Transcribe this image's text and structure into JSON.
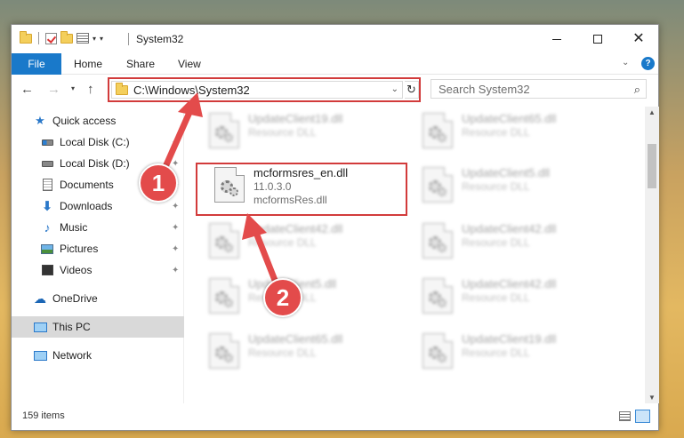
{
  "window": {
    "title": "System32"
  },
  "ribbon": {
    "file": "File",
    "home": "Home",
    "share": "Share",
    "view": "View"
  },
  "address": {
    "path": "C:\\Windows\\System32"
  },
  "search": {
    "placeholder": "Search System32"
  },
  "nav": {
    "quick_access": "Quick access",
    "local_c": "Local Disk (C:)",
    "local_d": "Local Disk (D:)",
    "documents": "Documents",
    "downloads": "Downloads",
    "music": "Music",
    "pictures": "Pictures",
    "videos": "Videos",
    "onedrive": "OneDrive",
    "this_pc": "This PC",
    "network": "Network"
  },
  "files": {
    "f1": {
      "name": "UpdateClient19.dll",
      "type": "Resource DLL"
    },
    "f2": {
      "name": "UpdateClient65.dll",
      "type": "Resource DLL"
    },
    "f3": {
      "name": "mcformsres_en.dll",
      "version": "11.0.3.0",
      "desc": "mcformsRes.dll"
    },
    "f4": {
      "name": "UpdateClient5.dll",
      "type": "Resource DLL"
    },
    "f5": {
      "name": "UpdateClient42.dll",
      "type": "Resource DLL"
    },
    "f6": {
      "name": "UpdateClient42.dll",
      "type": "Resource DLL"
    },
    "f7": {
      "name": "UpdateClient5.dll",
      "type": "Resource DLL"
    },
    "f8": {
      "name": "UpdateClient42.dll",
      "type": "Resource DLL"
    },
    "f9": {
      "name": "UpdateClient65.dll",
      "type": "Resource DLL"
    },
    "f10": {
      "name": "UpdateClient19.dll",
      "type": "Resource DLL"
    }
  },
  "status": {
    "count": "159 items"
  },
  "callouts": {
    "one": "1",
    "two": "2"
  },
  "colors": {
    "accent": "#1979ca",
    "highlight": "#d23b3b",
    "callout": "#e34b4b"
  }
}
